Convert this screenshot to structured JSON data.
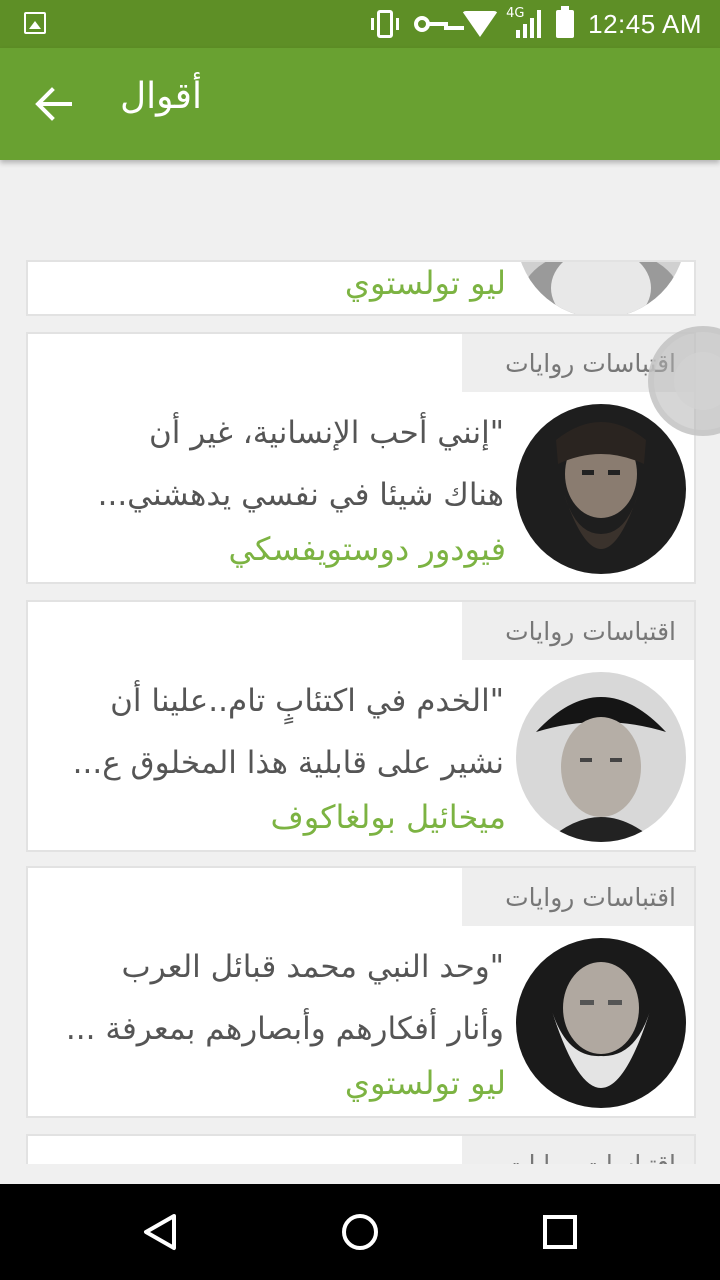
{
  "status_bar": {
    "time": "12:45 AM",
    "network": "4G",
    "icons": [
      "gallery-icon",
      "vibrate-icon",
      "vpn-key-icon",
      "wifi-icon",
      "signal-icon",
      "battery-icon"
    ]
  },
  "app_bar": {
    "title": "أقوال",
    "back_icon": "arrow-back-icon",
    "color": "#69a131"
  },
  "cards": [
    {
      "category": "",
      "quote_lines": [],
      "author": "ليو تولستوي"
    },
    {
      "category": "اقتباسات روايات",
      "quote_lines": [
        "\"إنني أحب الإنسانية، غير أن",
        "هناك شيئا في نفسي يدهشني..."
      ],
      "author": "فيودور دوستويفسكي"
    },
    {
      "category": "اقتباسات روايات",
      "quote_lines": [
        "\"الخدم في اكتئابٍ تام..علينا أن",
        "نشير على قابلية هذا المخلوق ع..."
      ],
      "author": "ميخائيل بولغاكوف"
    },
    {
      "category": "اقتباسات روايات",
      "quote_lines": [
        "\"وحد النبي محمد قبائل العرب",
        "وأنار أفكارهم وأبصارهم بمعرفة ..."
      ],
      "author": "ليو تولستوي"
    },
    {
      "category": "اقتباسات روايات",
      "quote_lines": [],
      "author": ""
    }
  ],
  "nav_bar": {
    "icons": [
      "back-triangle-icon",
      "home-circle-icon",
      "recents-square-icon"
    ]
  },
  "colors": {
    "status_bar": "#5e8f26",
    "accent": "#7cb342",
    "text": "#555555"
  }
}
